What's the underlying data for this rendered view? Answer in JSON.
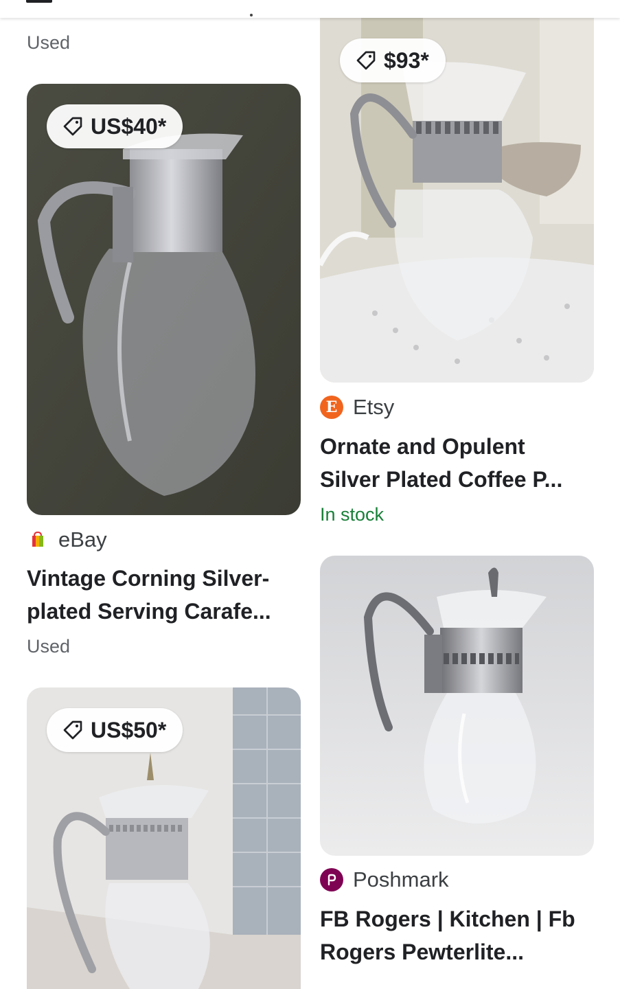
{
  "left_column": {
    "top_condition": "Used",
    "items": [
      {
        "price": "US$40*",
        "source": "eBay",
        "title_line1": "Vintage Corning Silver-",
        "title_line2": "plated Serving Carafe...",
        "condition": "Used"
      },
      {
        "price": "US$50*"
      }
    ]
  },
  "right_column": {
    "items": [
      {
        "price": "$93*",
        "source": "Etsy",
        "source_logo_letter": "E",
        "title_line1": "Ornate and Opulent",
        "title_line2": "Silver Plated Coffee P...",
        "availability": "In stock"
      },
      {
        "source": "Poshmark",
        "title_line1": "FB Rogers | Kitchen | Fb",
        "title_line2": "Rogers Pewterlite..."
      }
    ]
  },
  "colors": {
    "availability_green": "#188038",
    "etsy_orange": "#f1641e",
    "poshmark_maroon": "#7f0353"
  }
}
